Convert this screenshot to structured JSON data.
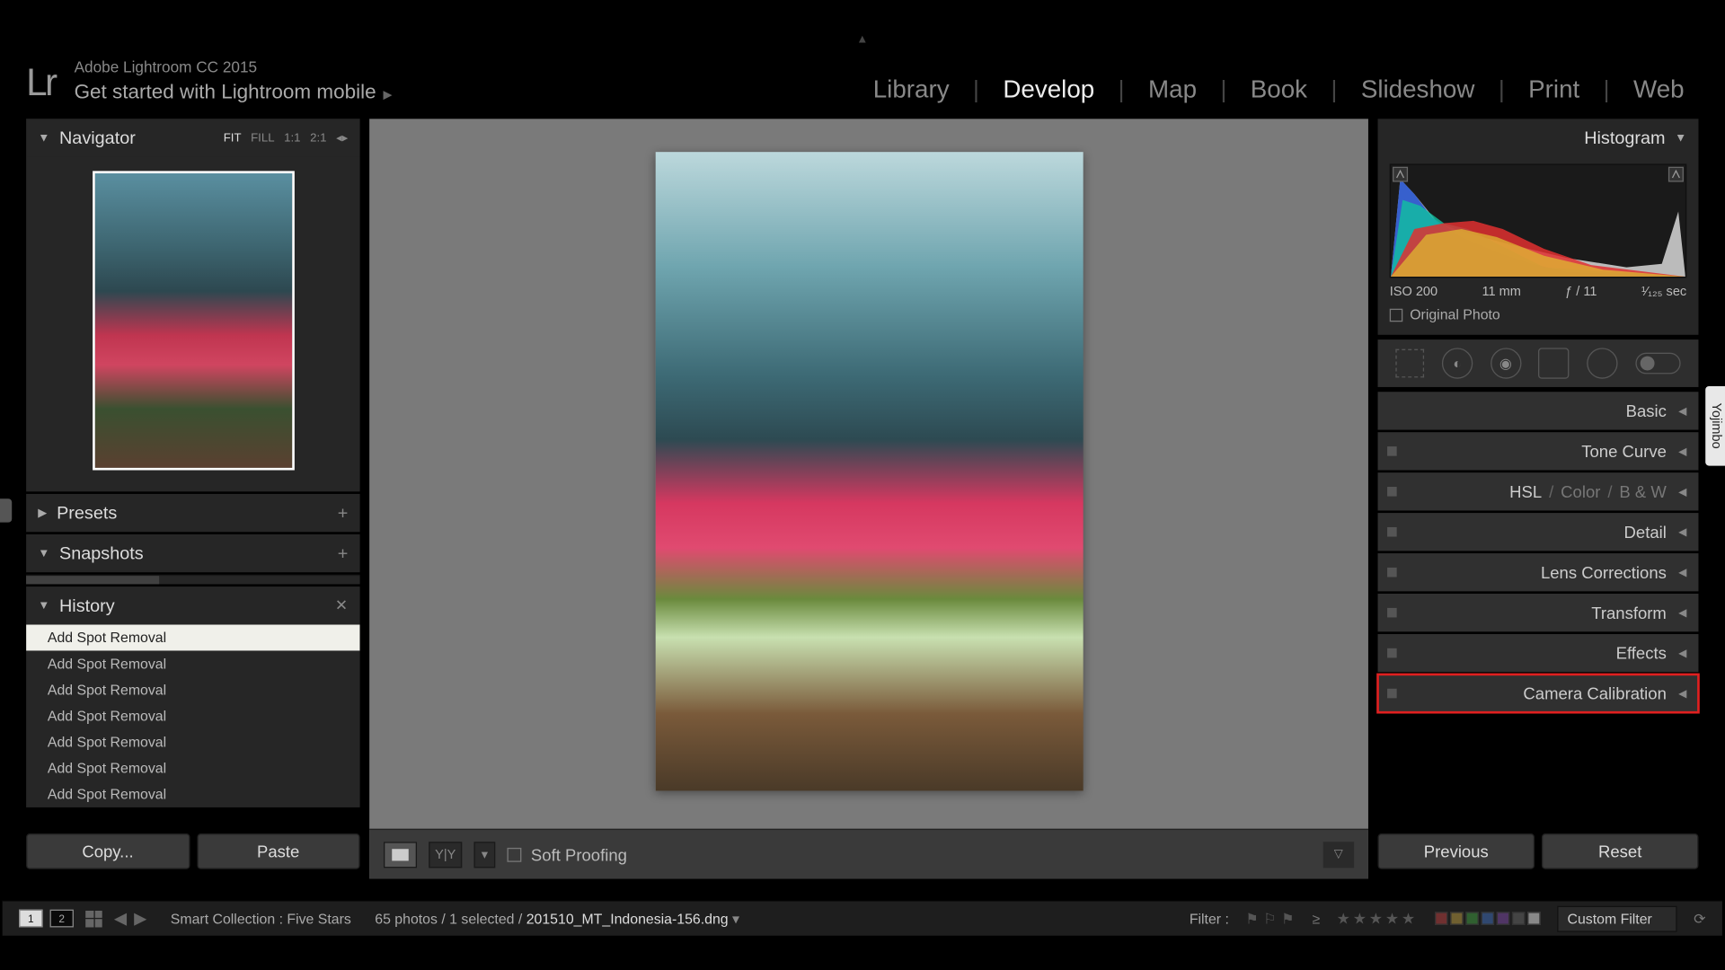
{
  "app": {
    "title": "Adobe Lightroom CC 2015",
    "subtitle": "Get started with Lightroom mobile",
    "logo": "Lr"
  },
  "modules": {
    "items": [
      "Library",
      "Develop",
      "Map",
      "Book",
      "Slideshow",
      "Print",
      "Web"
    ],
    "active": "Develop"
  },
  "left": {
    "navigator": {
      "title": "Navigator",
      "zoom_fit": "FIT",
      "zoom_fill": "FILL",
      "zoom_1": "1:1",
      "zoom_2": "2:1"
    },
    "presets": {
      "title": "Presets"
    },
    "snapshots": {
      "title": "Snapshots"
    },
    "history": {
      "title": "History",
      "items": [
        "Add Spot Removal",
        "Add Spot Removal",
        "Add Spot Removal",
        "Add Spot Removal",
        "Add Spot Removal",
        "Add Spot Removal",
        "Add Spot Removal"
      ]
    },
    "copy": "Copy...",
    "paste": "Paste"
  },
  "center": {
    "soft_proofing": "Soft Proofing"
  },
  "right": {
    "histogram_title": "Histogram",
    "meta": {
      "iso": "ISO 200",
      "focal": "11 mm",
      "aperture": "ƒ / 11",
      "shutter": "¹⁄₁₂₅ sec"
    },
    "original_photo": "Original Photo",
    "panels": {
      "basic": "Basic",
      "tone_curve": "Tone Curve",
      "hsl": "HSL",
      "color": "Color",
      "bw": "B & W",
      "detail": "Detail",
      "lens": "Lens Corrections",
      "transform": "Transform",
      "effects": "Effects",
      "camera_cal": "Camera Calibration"
    },
    "previous": "Previous",
    "reset": "Reset"
  },
  "status": {
    "collection": "Smart Collection : Five Stars",
    "count": "65 photos / 1 selected / ",
    "file": "201510_MT_Indonesia-156.dng",
    "filter_label": "Filter :",
    "custom_filter": "Custom Filter",
    "side_tab": "Yojimbo",
    "monitor1": "1",
    "monitor2": "2",
    "ge": "≥"
  },
  "colors": {
    "swatches": [
      "#b03030",
      "#c8a030",
      "#4a9a40",
      "#3a70c0",
      "#9050b0",
      "#888888",
      "#cccccc"
    ]
  }
}
